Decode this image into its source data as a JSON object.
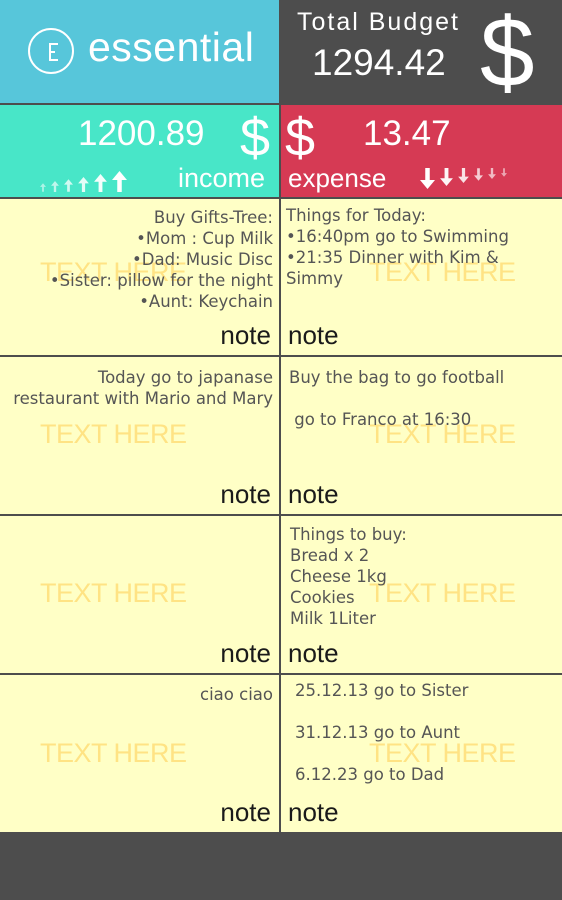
{
  "app": {
    "title": "essential"
  },
  "budget": {
    "label": "Total Budget",
    "value": "1294.42",
    "currency_symbol": "$"
  },
  "income": {
    "value": "1200.89",
    "currency_symbol": "$",
    "label": "income",
    "arrow_icon": "arrow-up-icon"
  },
  "expense": {
    "value": "13.47",
    "currency_symbol": "$",
    "label": "expense",
    "arrow_icon": "arrow-down-icon"
  },
  "colors": {
    "brand": "#57c6da",
    "income": "#48e6c8",
    "expense": "#d63a54",
    "header_dark": "#4d4d4d",
    "note_background": "#ffffc6"
  },
  "notes": [
    {
      "text": "Buy Gifts-Tree:\n•Mom : Cup Milk\n•Dad: Music Disc\n•Sister: pillow for the night\n•Aunt: Keychain",
      "placeholder": "TEXT HERE",
      "label": "note"
    },
    {
      "text": "Things for Today:\n•16:40pm go to Swimming\n•21:35 Dinner with Kim &\nSimmy",
      "placeholder": "TEXT HERE",
      "label": "note"
    },
    {
      "text": "Today go to japanase\nrestaurant with Mario and Mary",
      "placeholder": "TEXT HERE",
      "label": "note"
    },
    {
      "text": "Buy the bag to go football\n\n go to Franco at 16:30",
      "placeholder": "TEXT HERE",
      "label": "note"
    },
    {
      "text": "",
      "placeholder": "TEXT HERE",
      "label": "note"
    },
    {
      "text": "Things to buy:\nBread x 2\nCheese 1kg\nCookies\nMilk 1Liter",
      "placeholder": "TEXT HERE",
      "label": "note"
    },
    {
      "text": "ciao ciao",
      "placeholder": "TEXT HERE",
      "label": "note"
    },
    {
      "text": "25.12.13 go to Sister\n\n31.12.13 go to Aunt\n\n6.12.23 go to Dad",
      "placeholder": "TEXT HERE",
      "label": "note"
    }
  ]
}
